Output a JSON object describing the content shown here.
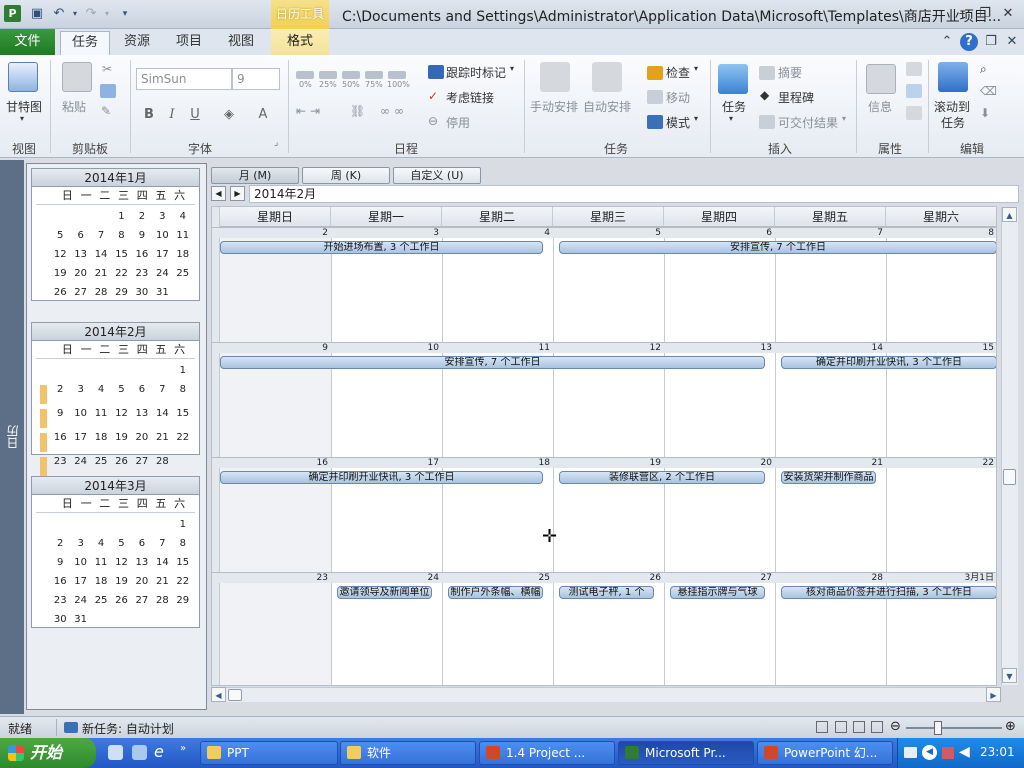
{
  "title_bar": {
    "context_tab_group": "日历工具",
    "window_title": "C:\\Documents and Settings\\Administrator\\Application Data\\Microsoft\\Templates\\商店开业项目..."
  },
  "ribbon_tabs": {
    "file": "文件",
    "tabs": [
      "任务",
      "资源",
      "项目",
      "视图"
    ],
    "format": "格式"
  },
  "ribbon": {
    "view_group": {
      "gantt": "甘特图",
      "label": "视图"
    },
    "clipboard": {
      "paste": "粘贴",
      "label": "剪贴板"
    },
    "font": {
      "font_name": "SimSun",
      "font_size": "9",
      "label": "字体"
    },
    "schedule": {
      "zooms": [
        "0%",
        "25%",
        "50%",
        "75%",
        "100%"
      ],
      "track": "跟踪时标记",
      "respect_links": "考虑链接",
      "inactivate": "停用",
      "label": "日程"
    },
    "tasks": {
      "manual": "手动安排",
      "auto": "自动安排",
      "inspect": "检查",
      "move": "移动",
      "mode": "模式",
      "label": "任务"
    },
    "insert": {
      "task": "任务",
      "summary": "摘要",
      "milestone": "里程碑",
      "deliverable": "可交付结果",
      "label": "插入"
    },
    "properties": {
      "info": "信息",
      "label": "属性"
    },
    "editing": {
      "scroll_to_task": "滚动到",
      "scroll_to_task2": "任务",
      "label": "编辑"
    }
  },
  "sidebar": {
    "strip_label": "日历",
    "calendars": [
      {
        "title": "2014年1月",
        "rows": [
          [
            "",
            "",
            "",
            "1",
            "2",
            "3",
            "4"
          ],
          [
            "5",
            "6",
            "7",
            "8",
            "9",
            "10",
            "11"
          ],
          [
            "12",
            "13",
            "14",
            "15",
            "16",
            "17",
            "18"
          ],
          [
            "19",
            "20",
            "21",
            "22",
            "23",
            "24",
            "25"
          ],
          [
            "26",
            "27",
            "28",
            "29",
            "30",
            "31",
            ""
          ]
        ],
        "marks": [
          false,
          false,
          false,
          false,
          false
        ]
      },
      {
        "title": "2014年2月",
        "rows": [
          [
            "",
            "",
            "",
            "",
            "",
            "",
            "1"
          ],
          [
            "2",
            "3",
            "4",
            "5",
            "6",
            "7",
            "8"
          ],
          [
            "9",
            "10",
            "11",
            "12",
            "13",
            "14",
            "15"
          ],
          [
            "16",
            "17",
            "18",
            "19",
            "20",
            "21",
            "22"
          ],
          [
            "23",
            "24",
            "25",
            "26",
            "27",
            "28",
            ""
          ]
        ],
        "marks": [
          false,
          true,
          true,
          true,
          true
        ]
      },
      {
        "title": "2014年3月",
        "rows": [
          [
            "",
            "",
            "",
            "",
            "",
            "",
            "1"
          ],
          [
            "2",
            "3",
            "4",
            "5",
            "6",
            "7",
            "8"
          ],
          [
            "9",
            "10",
            "11",
            "12",
            "13",
            "14",
            "15"
          ],
          [
            "16",
            "17",
            "18",
            "19",
            "20",
            "21",
            "22"
          ],
          [
            "23",
            "24",
            "25",
            "26",
            "27",
            "28",
            "29"
          ],
          [
            "30",
            "31",
            "",
            "",
            "",
            "",
            ""
          ]
        ],
        "marks": [
          false,
          false,
          false,
          false,
          false,
          false
        ]
      }
    ],
    "weekday_heads": [
      "日",
      "一",
      "二",
      "三",
      "四",
      "五",
      "六"
    ]
  },
  "calendar_view": {
    "view_buttons": [
      "月 (M)",
      "周 (K)",
      "自定义 (U)"
    ],
    "month_label": "2014年2月",
    "day_headers": [
      "星期日",
      "星期一",
      "星期二",
      "星期三",
      "星期四",
      "星期五",
      "星期六"
    ],
    "weeks": [
      {
        "days": [
          "2",
          "3",
          "4",
          "5",
          "6",
          "7",
          "8"
        ]
      },
      {
        "days": [
          "9",
          "10",
          "11",
          "12",
          "13",
          "14",
          "15"
        ]
      },
      {
        "days": [
          "16",
          "17",
          "18",
          "19",
          "20",
          "21",
          "22"
        ]
      },
      {
        "days": [
          "23",
          "24",
          "25",
          "26",
          "27",
          "28",
          "3月1日"
        ]
      }
    ],
    "tasks": [
      {
        "week": 0,
        "start": 0,
        "span": 3,
        "label": "开始进场布置, 3 个工作日"
      },
      {
        "week": 0,
        "start": 3,
        "span": 4,
        "label": "安排宣传, 7 个工作日"
      },
      {
        "week": 1,
        "start": 0,
        "span": 5,
        "label": "安排宣传, 7 个工作日"
      },
      {
        "week": 1,
        "start": 5,
        "span": 2,
        "label": "确定并印刷开业快讯, 3 个工作日"
      },
      {
        "week": 2,
        "start": 0,
        "span": 3,
        "label": "确定并印刷开业快讯, 3 个工作日"
      },
      {
        "week": 2,
        "start": 3,
        "span": 2,
        "label": "装修联营区, 2 个工作日"
      },
      {
        "week": 2,
        "start": 5,
        "span": 1,
        "label": "安装货架并制作商品"
      },
      {
        "week": 3,
        "start": 1,
        "span": 1,
        "label": "邀请领导及新闻单位"
      },
      {
        "week": 3,
        "start": 2,
        "span": 1,
        "label": "制作户外条幅、横幅"
      },
      {
        "week": 3,
        "start": 3,
        "span": 1,
        "label": "测试电子秤, 1 个"
      },
      {
        "week": 3,
        "start": 4,
        "span": 1,
        "label": "悬挂指示牌与气球"
      },
      {
        "week": 3,
        "start": 5,
        "span": 2,
        "label": "核对商品价签并进行扫描, 3 个工作日"
      }
    ]
  },
  "status_bar": {
    "ready": "就绪",
    "new_tasks": "新任务: 自动计划"
  },
  "taskbar": {
    "start": "开始",
    "buttons": [
      "PPT",
      "软件",
      "1.4 Project ...",
      "Microsoft Pr...",
      "PowerPoint 幻..."
    ],
    "clock": "23:01"
  }
}
